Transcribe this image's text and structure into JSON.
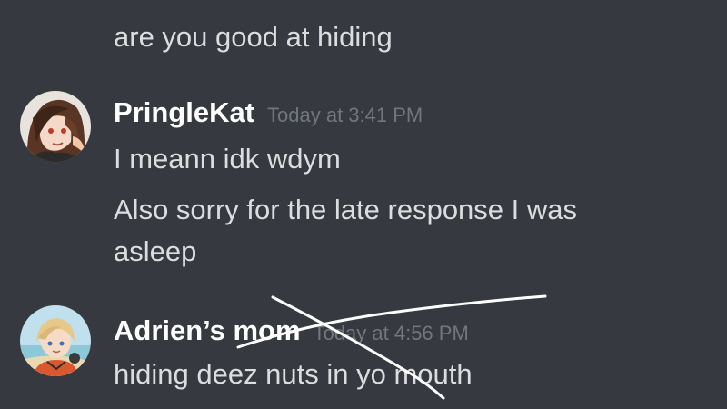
{
  "messages": [
    {
      "content": "are you good at hiding"
    },
    {
      "author": "PringleKat",
      "timestamp": "Today at 3:41 PM",
      "lines": [
        "I meann idk wdym",
        "Also sorry for the late response I was",
        "asleep"
      ],
      "avatar_icon": "anime-character-avatar"
    },
    {
      "author": "Adrien’s mom",
      "timestamp": "Today at 4:56 PM",
      "lines": [
        "hiding deez nuts in yo mouth"
      ],
      "avatar_icon": "anime-character-avatar"
    }
  ],
  "colors": {
    "background": "#36393f",
    "text": "#dcddde",
    "username": "#ffffff",
    "timestamp": "#72767d",
    "strike_mark": "#ffffff"
  }
}
